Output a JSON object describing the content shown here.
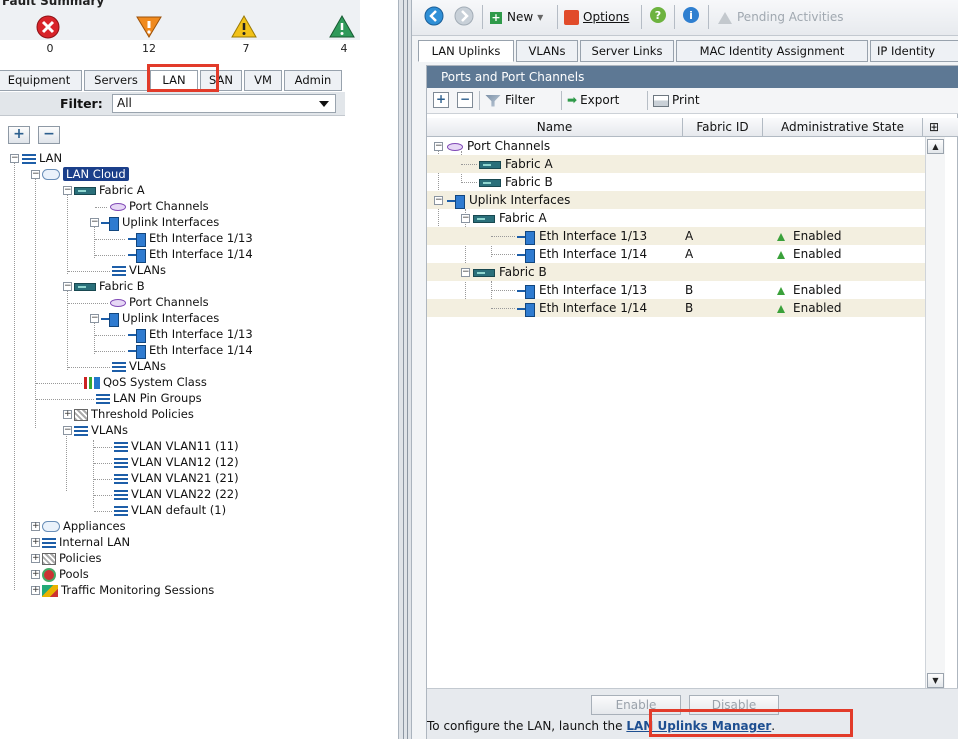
{
  "fault_summary": {
    "title": "Fault Summary",
    "items": [
      {
        "icon": "critical-x-icon",
        "color": "#d8242a",
        "count": "0"
      },
      {
        "icon": "major-down-triangle-icon",
        "color": "#f08a1e",
        "count": "12"
      },
      {
        "icon": "minor-warning-triangle-icon",
        "color": "#f2c219",
        "count": "7"
      },
      {
        "icon": "warning-triangle-icon",
        "color": "#2f9a5a",
        "count": "4"
      }
    ]
  },
  "left_tabs": [
    "Equipment",
    "Servers",
    "LAN",
    "SAN",
    "VM",
    "Admin"
  ],
  "left_active_tab": "LAN",
  "filter": {
    "label": "Filter:",
    "value": "All"
  },
  "tree": {
    "root": "LAN",
    "lan_cloud": "LAN Cloud",
    "fabric_a": "Fabric A",
    "port_channels": "Port Channels",
    "uplink_interfaces": "Uplink Interfaces",
    "eth_1_13": "Eth Interface 1/13",
    "eth_1_14": "Eth Interface 1/14",
    "vlans": "VLANs",
    "fabric_b": "Fabric B",
    "qos": "QoS System Class",
    "pin_groups": "LAN Pin Groups",
    "threshold": "Threshold Policies",
    "vlan_list": [
      "VLAN VLAN11 (11)",
      "VLAN VLAN12 (12)",
      "VLAN VLAN21 (21)",
      "VLAN VLAN22 (22)",
      "VLAN default (1)"
    ],
    "appliances": "Appliances",
    "internal_lan": "Internal LAN",
    "policies": "Policies",
    "pools": "Pools",
    "traffic": "Traffic Monitoring Sessions"
  },
  "toolbar": {
    "new": "New",
    "options": "Options",
    "pending": "Pending Activities"
  },
  "right_tabs": [
    "LAN Uplinks",
    "VLANs",
    "Server Links",
    "MAC Identity Assignment",
    "IP Identity"
  ],
  "right_active_tab": "LAN Uplinks",
  "panel": {
    "title": "Ports and Port Channels",
    "filter": "Filter",
    "export": "Export",
    "print": "Print",
    "columns": [
      "Name",
      "Fabric ID",
      "Administrative State"
    ],
    "rows": [
      {
        "name": "Port Channels",
        "fabric": "",
        "state": ""
      },
      {
        "name": "Fabric A",
        "fabric": "",
        "state": ""
      },
      {
        "name": "Fabric B",
        "fabric": "",
        "state": ""
      },
      {
        "name": "Uplink Interfaces",
        "fabric": "",
        "state": ""
      },
      {
        "name": "Fabric A",
        "fabric": "",
        "state": ""
      },
      {
        "name": "Eth Interface 1/13",
        "fabric": "A",
        "state": "Enabled"
      },
      {
        "name": "Eth Interface 1/14",
        "fabric": "A",
        "state": "Enabled"
      },
      {
        "name": "Fabric B",
        "fabric": "",
        "state": ""
      },
      {
        "name": "Eth Interface 1/13",
        "fabric": "B",
        "state": "Enabled"
      },
      {
        "name": "Eth Interface 1/14",
        "fabric": "B",
        "state": "Enabled"
      }
    ],
    "enable": "Enable",
    "disable": "Disable",
    "config_prefix": "To configure the LAN, launch the ",
    "config_link": "LAN Uplinks Manager",
    "config_suffix": "."
  }
}
